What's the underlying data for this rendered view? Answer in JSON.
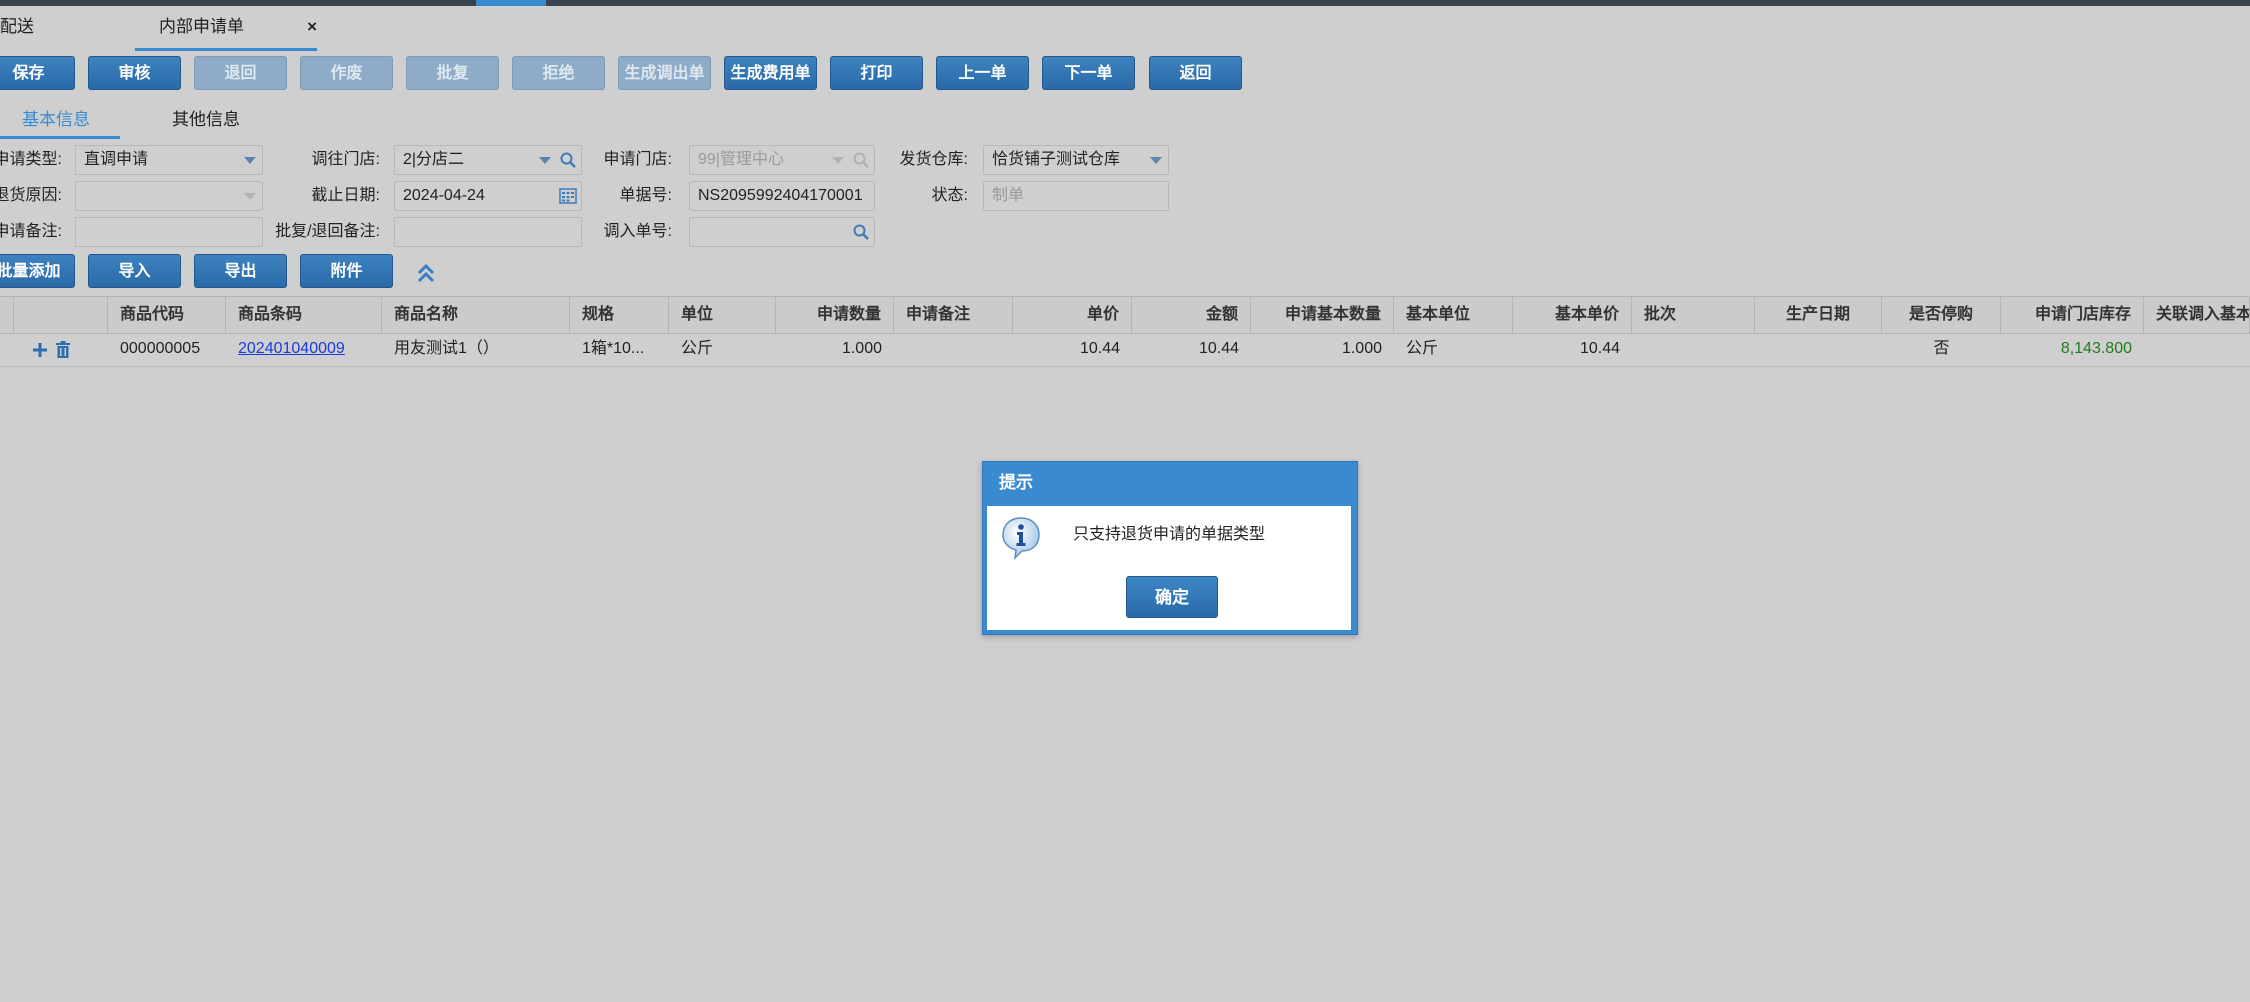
{
  "tabs": [
    {
      "label": "配送"
    },
    {
      "label": "内部申请单",
      "close": "×"
    }
  ],
  "toolbar": {
    "buttons": [
      {
        "label": "保存",
        "enabled": true
      },
      {
        "label": "审核",
        "enabled": true
      },
      {
        "label": "退回",
        "enabled": false
      },
      {
        "label": "作废",
        "enabled": false
      },
      {
        "label": "批复",
        "enabled": false
      },
      {
        "label": "拒绝",
        "enabled": false
      },
      {
        "label": "生成调出单",
        "enabled": false
      },
      {
        "label": "生成费用单",
        "enabled": true
      },
      {
        "label": "打印",
        "enabled": true
      },
      {
        "label": "上一单",
        "enabled": true
      },
      {
        "label": "下一单",
        "enabled": true
      },
      {
        "label": "返回",
        "enabled": true
      }
    ]
  },
  "subtabs": [
    {
      "label": "基本信息",
      "active": true
    },
    {
      "label": "其他信息",
      "active": false
    }
  ],
  "form": {
    "apply_type_label": "申请类型:",
    "apply_type_value": "直调申请",
    "to_store_label": "调往门店:",
    "to_store_value": "2|分店二",
    "apply_store_label": "申请门店:",
    "apply_store_value": "99|管理中心",
    "warehouse_label": "发货仓库:",
    "warehouse_value": "恰货铺子测试仓库",
    "return_reason_label": "退货原因:",
    "return_reason_value": "",
    "deadline_label": "截止日期:",
    "deadline_value": "2024-04-24",
    "doc_no_label": "单据号:",
    "doc_no_value": "NS2095992404170001",
    "status_label": "状态:",
    "status_value": "制单",
    "apply_note_label": "申请备注:",
    "apply_note_value": "",
    "reply_note_label": "批复/退回备注:",
    "reply_note_value": "",
    "in_doc_label": "调入单号:",
    "in_doc_value": ""
  },
  "actions": [
    {
      "label": "批量添加"
    },
    {
      "label": "导入"
    },
    {
      "label": "导出"
    },
    {
      "label": "附件"
    }
  ],
  "grid": {
    "columns": [
      "商品代码",
      "商品条码",
      "商品名称",
      "规格",
      "单位",
      "申请数量",
      "申请备注",
      "单价",
      "金额",
      "申请基本数量",
      "基本单位",
      "基本单价",
      "批次",
      "生产日期",
      "是否停购",
      "申请门店库存",
      "关联调入基本"
    ],
    "rows": [
      {
        "code": "000000005",
        "barcode": "202401040009",
        "name": "用友测试1（）",
        "spec": "1箱*10...",
        "unit": "公斤",
        "qty": "1.000",
        "note": "",
        "price": "10.44",
        "amount": "10.44",
        "base_qty": "1.000",
        "base_unit": "公斤",
        "base_price": "10.44",
        "batch": "",
        "prod_date": "",
        "stopped": "否",
        "stock": "8,143.800"
      }
    ]
  },
  "dialog": {
    "title": "提示",
    "message": "只支持退货申请的单据类型",
    "ok": "确定"
  },
  "colors": {
    "accent": "#3a8ad0",
    "button": "#2e6fad",
    "stock_green": "#1f7a1f",
    "link": "#1a3cd6"
  }
}
